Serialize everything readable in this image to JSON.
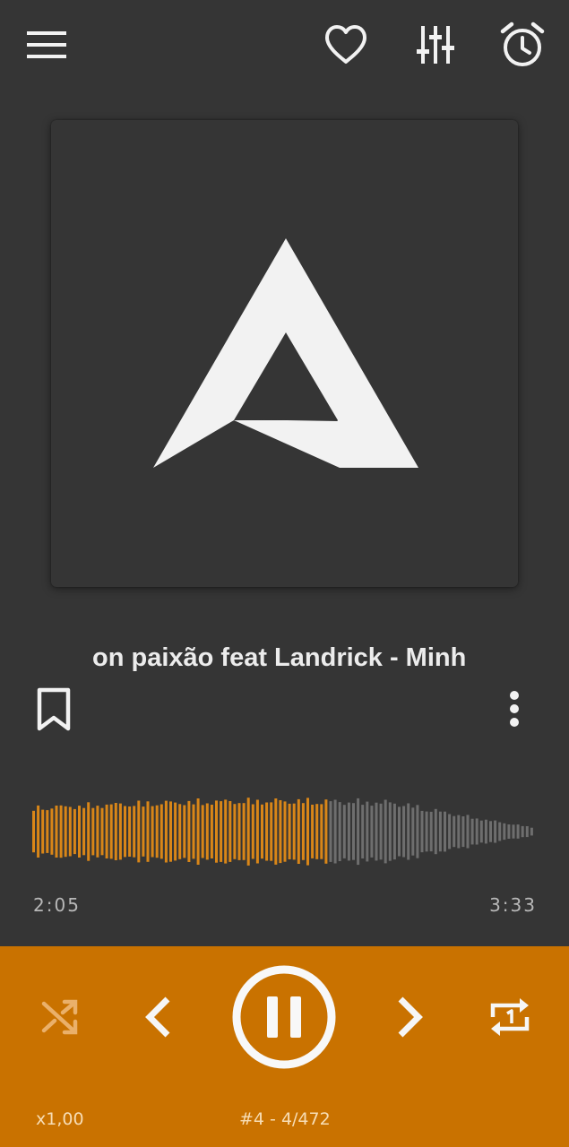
{
  "toolbar": {
    "menu_icon": "hamburger-menu-icon",
    "favorite_icon": "heart-outline-icon",
    "equalizer_icon": "equalizer-sliders-icon",
    "sleep_timer_icon": "alarm-clock-icon"
  },
  "now_playing": {
    "title_visible": "on paixão feat Landrick - Minh",
    "bookmark_icon": "bookmark-outline-icon",
    "more_icon": "more-vertical-icon"
  },
  "playback": {
    "elapsed": "2:05",
    "duration": "3:33",
    "progress_fraction": 0.587
  },
  "controls": {
    "shuffle_icon": "shuffle-icon",
    "previous_icon": "chevron-left-icon",
    "play_pause_icon": "pause-icon",
    "next_icon": "chevron-right-icon",
    "repeat_icon": "repeat-one-icon",
    "speed": "x1,00",
    "queue_position": "#4 - 4/472"
  },
  "colors": {
    "background": "#353535",
    "accent": "#c97200",
    "waveform_played": "#d98618",
    "waveform_unplayed": "#6e6e6e",
    "icon": "#f2f2f2"
  }
}
